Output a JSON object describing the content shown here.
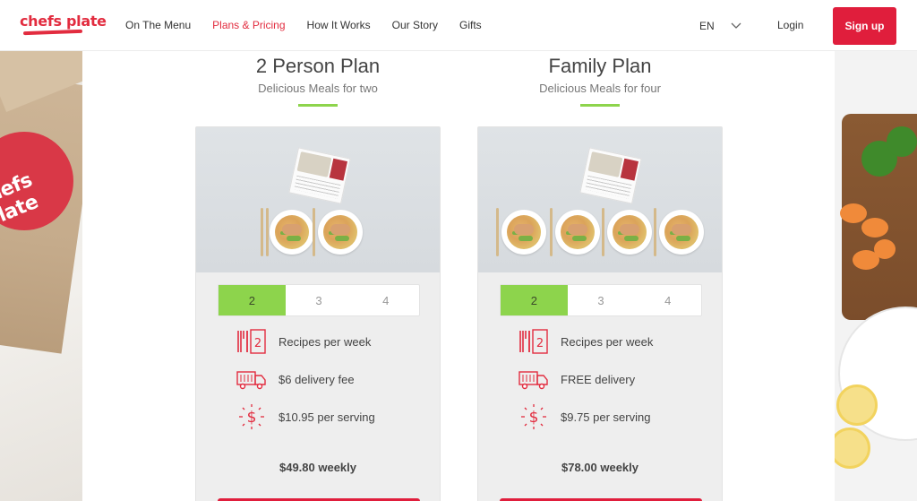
{
  "brand": {
    "name": "chefs plate",
    "color": "#e22c3f"
  },
  "nav": {
    "links": [
      {
        "label": "On The Menu",
        "active": false
      },
      {
        "label": "Plans & Pricing",
        "active": true
      },
      {
        "label": "How It Works",
        "active": false
      },
      {
        "label": "Our Story",
        "active": false
      },
      {
        "label": "Gifts",
        "active": false
      }
    ],
    "language": "EN",
    "login": "Login",
    "signup": "Sign up"
  },
  "colors": {
    "accent": "#e01e3c",
    "selected": "#8dd44c"
  },
  "side": {
    "box_logo_text": "chefs plate"
  },
  "plans": [
    {
      "title": "2 Person Plan",
      "subtitle": "Delicious Meals for two",
      "options": [
        "2",
        "3",
        "4"
      ],
      "selected_option": "2",
      "features": {
        "recipes_count": "2",
        "recipes": "Recipes per week",
        "delivery": "$6 delivery fee",
        "serving": "$10.95 per serving"
      },
      "weekly": "$49.80 weekly"
    },
    {
      "title": "Family Plan",
      "subtitle": "Delicious Meals for four",
      "options": [
        "2",
        "3",
        "4"
      ],
      "selected_option": "2",
      "features": {
        "recipes_count": "2",
        "recipes": "Recipes per week",
        "delivery": "FREE delivery",
        "serving": "$9.75 per serving"
      },
      "weekly": "$78.00 weekly"
    }
  ]
}
